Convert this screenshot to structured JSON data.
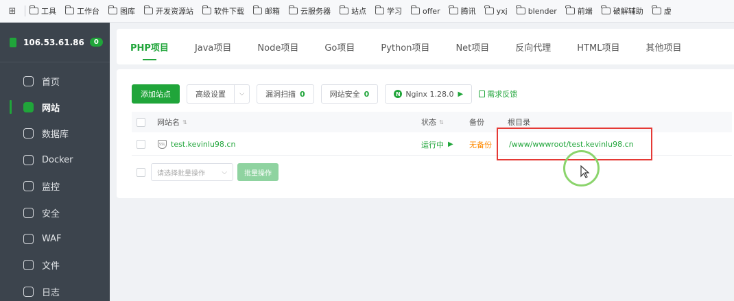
{
  "bookmarks": [
    "工具",
    "工作台",
    "图库",
    "开发资源站",
    "软件下载",
    "邮箱",
    "云服务器",
    "站点",
    "学习",
    "offer",
    "腾讯",
    "yxj",
    "blender",
    "前端",
    "破解辅助",
    "虚"
  ],
  "sidebar": {
    "server_ip": "106.53.61.86",
    "server_badge": "0",
    "items": [
      {
        "label": "首页",
        "icon": "home-icon"
      },
      {
        "label": "网站",
        "icon": "website-icon"
      },
      {
        "label": "数据库",
        "icon": "database-icon"
      },
      {
        "label": "Docker",
        "icon": "docker-icon"
      },
      {
        "label": "监控",
        "icon": "monitor-icon"
      },
      {
        "label": "安全",
        "icon": "shield-icon"
      },
      {
        "label": "WAF",
        "icon": "waf-icon"
      },
      {
        "label": "文件",
        "icon": "folder-icon"
      },
      {
        "label": "日志",
        "icon": "log-icon"
      }
    ],
    "active_index": 1
  },
  "tabs": [
    "PHP项目",
    "Java项目",
    "Node项目",
    "Go项目",
    "Python项目",
    "Net项目",
    "反向代理",
    "HTML项目",
    "其他项目"
  ],
  "toolbar": {
    "add_site": "添加站点",
    "advanced_settings": "高级设置",
    "vuln_scan": "漏洞扫描",
    "vuln_count": "0",
    "site_security": "网站安全",
    "security_count": "0",
    "nginx": "Nginx 1.28.0",
    "feedback": "需求反馈"
  },
  "table": {
    "headers": {
      "name": "网站名",
      "status": "状态",
      "backup": "备份",
      "root": "根目录"
    },
    "rows": [
      {
        "name": "test.kevinlu98.cn",
        "status": "运行中",
        "backup": "无备份",
        "root": "/www/wwwroot/test.kevinlu98.cn"
      }
    ]
  },
  "batch": {
    "placeholder": "请选择批量操作",
    "button": "批量操作"
  },
  "colors": {
    "accent": "#20a53a",
    "warning": "#ff8a00",
    "sidebar": "#3c444d",
    "highlight": "#e53935"
  }
}
